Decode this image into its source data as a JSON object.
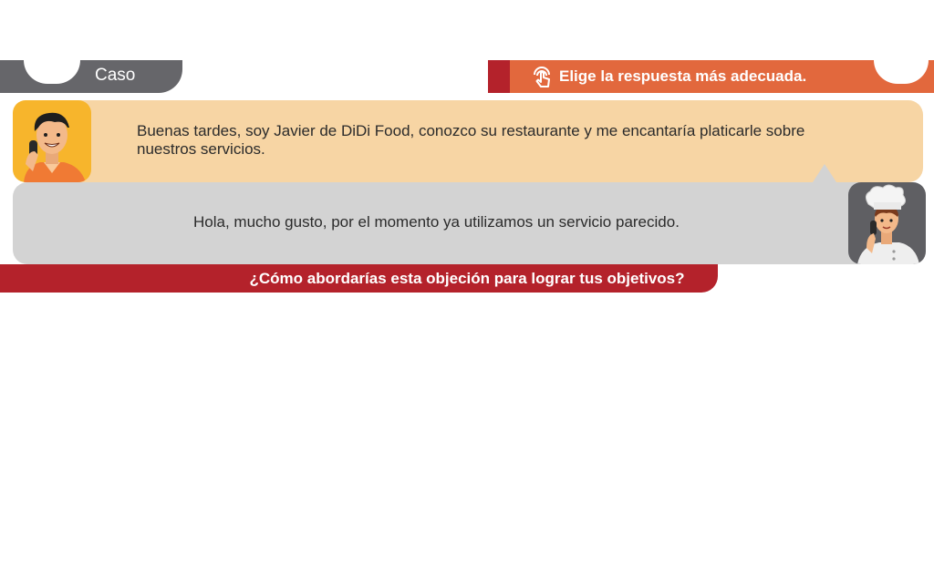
{
  "header": {
    "case_label": "Caso",
    "instruction_label": "Elige la respuesta más adecuada.",
    "instruction_icon": "touch-hand-icon"
  },
  "dialogue": {
    "agent_message": "Buenas tardes, soy Javier de DiDi Food, conozco su restaurante y me encantaría platicarle sobre nuestros servicios.",
    "owner_message": "Hola, mucho gusto, por el momento ya utilizamos un servicio parecido.",
    "agent_avatar": "salesman-on-phone-avatar",
    "owner_avatar": "chef-on-phone-avatar"
  },
  "question": {
    "text": "¿Cómo abordarías esta objeción para lograr tus objetivos?"
  },
  "colors": {
    "gray_tab": "#66666a",
    "orange_tab": "#e2683d",
    "dark_red": "#b4222b",
    "agent_bubble": "#f7d5a4",
    "owner_bubble": "#d3d3d3",
    "agent_avatar_bg": "#f7b52c",
    "owner_avatar_bg": "#5f5f63"
  }
}
